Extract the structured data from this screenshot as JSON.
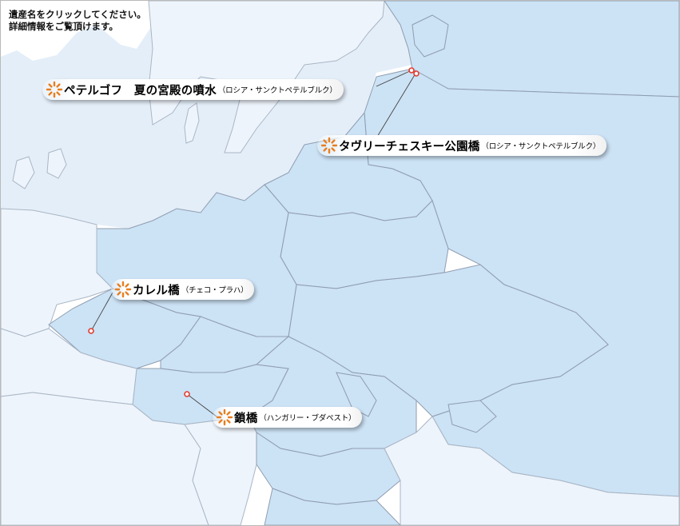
{
  "instructions": {
    "line1": "遺産名をクリックしてください。",
    "line2": "詳細情報をご覧頂けます。"
  },
  "colors": {
    "land_highlight": "#cce2f5",
    "land_light": "#e9f2fb",
    "water": "#e4eef8",
    "border": "#8f9db0",
    "marker": "#e23b2e",
    "icon": "#e87e1e"
  },
  "sites": [
    {
      "id": "peterhof",
      "name": "ペテルゴフ　夏の宮殿の噴水",
      "location": "（ロシア・サンクトペテルブルク）"
    },
    {
      "id": "tavrichesky",
      "name": "タヴリーチェスキー公園橋",
      "location": "（ロシア・サンクトペテルブルク）"
    },
    {
      "id": "charles",
      "name": "カレル橋",
      "location": "（チェコ・プラハ）"
    },
    {
      "id": "chain",
      "name": "鎖橋",
      "location": "（ハンガリー・ブダペスト）"
    }
  ],
  "icon": "sparkle-icon"
}
